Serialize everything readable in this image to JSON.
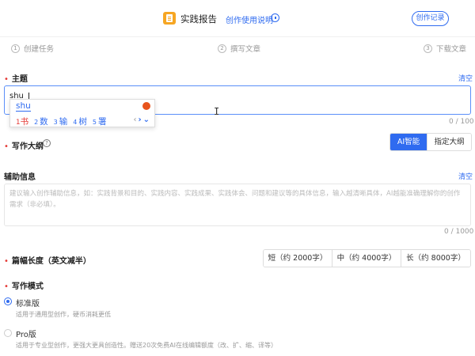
{
  "header": {
    "title": "实践报告",
    "help_link": "创作使用说明",
    "history_button": "创作记录"
  },
  "steps": [
    {
      "num": "1",
      "label": "创建任务"
    },
    {
      "num": "2",
      "label": "撰写文章"
    },
    {
      "num": "3",
      "label": "下载文章"
    }
  ],
  "topic": {
    "label": "主题",
    "clear": "清空",
    "value": "shu",
    "counter": "0 / 100"
  },
  "ime": {
    "input": "shu",
    "candidates": [
      {
        "num": "1",
        "text": "书"
      },
      {
        "num": "2",
        "text": "数"
      },
      {
        "num": "3",
        "text": "输"
      },
      {
        "num": "4",
        "text": "树"
      },
      {
        "num": "5",
        "text": "署"
      }
    ],
    "nav_prev": "‹",
    "nav_next": "›",
    "nav_more": "⌄"
  },
  "outline": {
    "label": "写作大纲",
    "help": "?",
    "options": [
      "AI智能",
      "指定大纲"
    ],
    "selected": "AI智能"
  },
  "aux": {
    "label": "辅助信息",
    "clear": "清空",
    "placeholder": "建议输入创作辅助信息，如：实践背景和目的、实践内容、实践成果、实践体会、问题和建议等的具体信息，输入越清晰具体，AI越能准确理解你的创作需求（非必填）。",
    "counter": "0 / 1000"
  },
  "length": {
    "label": "篇幅长度（英文减半）",
    "options": [
      "短（约 2000字）",
      "中（约 4000字）",
      "长（约 8000字）"
    ]
  },
  "mode": {
    "label": "写作模式",
    "options": [
      {
        "title": "标准版",
        "desc": "适用于通用型创作，硬币消耗更低",
        "selected": true
      },
      {
        "title": "Pro版",
        "desc": "适用于专业型创作，更强大更具创造性。赠送20次免费AI在线编辑额度（改、扩、缩、译等）",
        "selected": false
      }
    ]
  },
  "colors": {
    "accent": "#2f6bf0",
    "required": "#e53935"
  }
}
